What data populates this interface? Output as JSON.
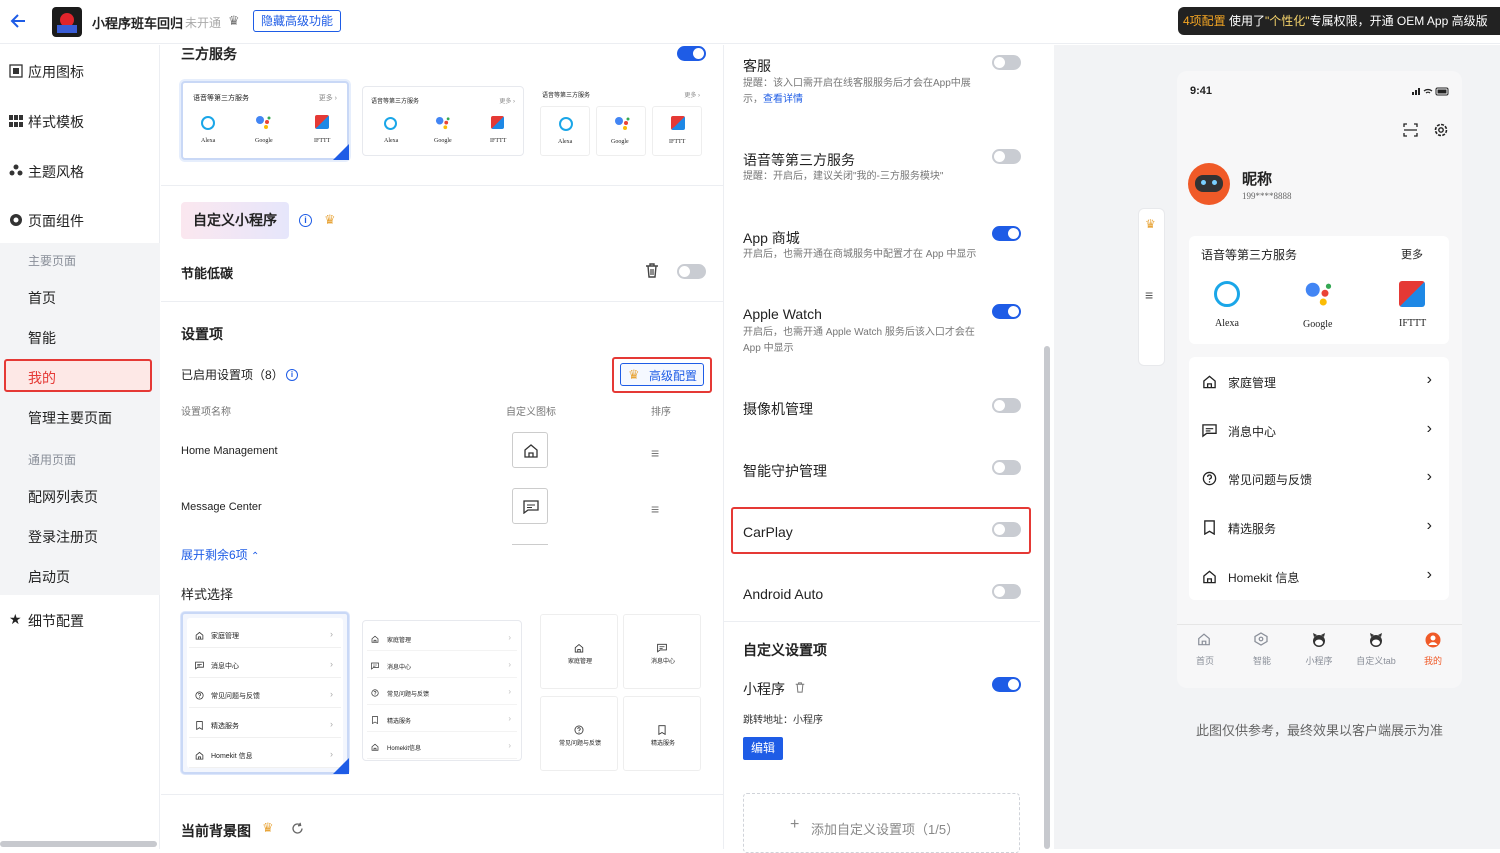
{
  "header": {
    "app_name": "小程序班车回归",
    "status": "未开通",
    "hide_btn": "隐藏高级功能",
    "banner_count": "4项配置",
    "banner_text_1": "使用了",
    "banner_highlight": "\"个性化\"",
    "banner_text_2": "专属权限，开通 OEM App 高级版"
  },
  "sidebar": {
    "app_icon": "应用图标",
    "style_template": "样式模板",
    "theme_style": "主题风格",
    "page_components": "页面组件",
    "main_pages_head": "主要页面",
    "home": "首页",
    "smart": "智能",
    "mine": "我的",
    "manage_main": "管理主要页面",
    "general_head": "通用页面",
    "network_list": "配网列表页",
    "login": "登录注册页",
    "launch": "启动页",
    "detail_config": "细节配置"
  },
  "left_panel": {
    "third_party_title": "三方服务",
    "svc_card_title": "语音等第三方服务",
    "svc_more": "更多",
    "svc_more_arrow": "›",
    "svc_alexa": "Alexa",
    "svc_google": "Google",
    "svc_ifttt": "IFTTT",
    "mini_program_tag": "自定义小程序",
    "energy_saving": "节能低碳",
    "settings_title": "设置项",
    "enabled_items": "已启用设置项（8）",
    "advanced_config": "高级配置",
    "col_name": "设置项名称",
    "col_icon": "自定义图标",
    "col_sort": "排序",
    "row1": "Home Management",
    "row2": "Message Center",
    "expand": "展开剩余6项",
    "style_select": "样式选择",
    "style_items": [
      "家庭管理",
      "消息中心",
      "常见问题与反馈",
      "精选服务",
      "Homekit 信息"
    ],
    "style_items_b": [
      "家庭管理",
      "消息中心",
      "常见问题与反馈",
      "精选服务",
      "Homekit信息"
    ],
    "grid_items": [
      "家庭管理",
      "消息中心",
      "常见问题与反馈",
      "精选服务"
    ],
    "bg_title": "当前背景图"
  },
  "middle_panel": {
    "customer_service": "客服",
    "customer_hint": "提醒：该入口需开启在线客服服务后才会在App中展示，",
    "view_detail": "查看详情",
    "voice_service": "语音等第三方服务",
    "voice_hint": "提醒：开启后，建议关闭\"我的-三方服务模块\"",
    "app_store": "App 商城",
    "app_store_hint": "开启后，也需开通在商城服务中配置才在 App 中显示",
    "apple_watch": "Apple Watch",
    "apple_watch_hint": "开启后，也需开通 Apple Watch 服务后该入口才会在 App 中显示",
    "camera": "摄像机管理",
    "guardian": "智能守护管理",
    "carplay": "CarPlay",
    "android_auto": "Android Auto",
    "custom_title": "自定义设置项",
    "mini_program": "小程序",
    "jump_label": "跳转地址：小程序",
    "edit_btn": "编辑",
    "add_custom": "添加自定义设置项（1/5）"
  },
  "phone": {
    "time": "9:41",
    "nickname": "昵称",
    "phone_number": "199****8888",
    "card_title": "语音等第三方服务",
    "card_more": "更多",
    "alexa": "Alexa",
    "google": "Google",
    "ifttt": "IFTTT",
    "rows": [
      "家庭管理",
      "消息中心",
      "常见问题与反馈",
      "精选服务",
      "Homekit 信息"
    ],
    "tabs": [
      "首页",
      "智能",
      "小程序",
      "自定义tab",
      "我的"
    ],
    "note": "此图仅供参考，最终效果以客户端展示为准"
  },
  "colors": {
    "accent": "#1e5ce6",
    "danger": "#e53935",
    "crown": "#e8a53a",
    "orange": "#f05a28"
  }
}
